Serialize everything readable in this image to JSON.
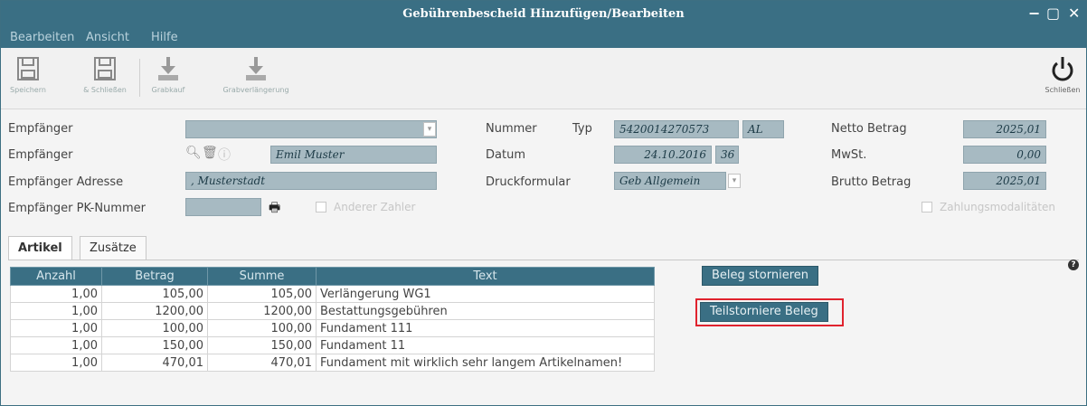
{
  "window": {
    "title": "Gebührenbescheid Hinzufügen/Bearbeiten",
    "controls": {
      "minimize": "−",
      "maximize": "▢",
      "close": "✕"
    }
  },
  "menu": {
    "items": [
      "Bearbeiten",
      "Ansicht",
      "Hilfe"
    ]
  },
  "toolbar": {
    "save": "Speichern",
    "save_close": "& Schließen",
    "grave_purchase": "Grabkauf",
    "grave_extension": "Grabverlängerung",
    "close": "Schließen"
  },
  "form": {
    "recipient_select_label": "Empfänger",
    "recipient_label": "Empfänger",
    "recipient_value": "Emil Muster",
    "address_label": "Empfänger Adresse",
    "address_value": ", Musterstadt",
    "pk_label": "Empfänger PK-Nummer",
    "other_payer_label": "Anderer Zahler",
    "number_label": "Nummer",
    "type_label": "Typ",
    "number_value": "5420014270573",
    "type_value": "AL",
    "date_label": "Datum",
    "date_value": "24.10.2016",
    "date_extra": "36",
    "print_form_label": "Druckformular",
    "print_form_value": "Geb Allgemein",
    "net_label": "Netto Betrag",
    "net_value": "2025,01",
    "vat_label": "MwSt.",
    "vat_value": "0,00",
    "gross_label": "Brutto Betrag",
    "gross_value": "2025,01",
    "payment_modalities_label": "Zahlungsmodalitäten"
  },
  "tabs": {
    "articles": "Artikel",
    "extras": "Zusätze"
  },
  "table": {
    "headers": [
      "Anzahl",
      "Betrag",
      "Summe",
      "Text"
    ],
    "rows": [
      [
        "1,00",
        "105,00",
        "105,00",
        "Verlängerung WG1"
      ],
      [
        "1,00",
        "1200,00",
        "1200,00",
        "Bestattungsgebühren"
      ],
      [
        "1,00",
        "100,00",
        "100,00",
        "Fundament 111"
      ],
      [
        "1,00",
        "150,00",
        "150,00",
        "Fundament 11"
      ],
      [
        "1,00",
        "470,01",
        "470,01",
        "Fundament mit wirklich sehr langem Artikelnamen!"
      ]
    ]
  },
  "buttons": {
    "cancel_receipt": "Beleg stornieren",
    "partial_cancel": "Teilstorniere Beleg"
  },
  "help": "?"
}
